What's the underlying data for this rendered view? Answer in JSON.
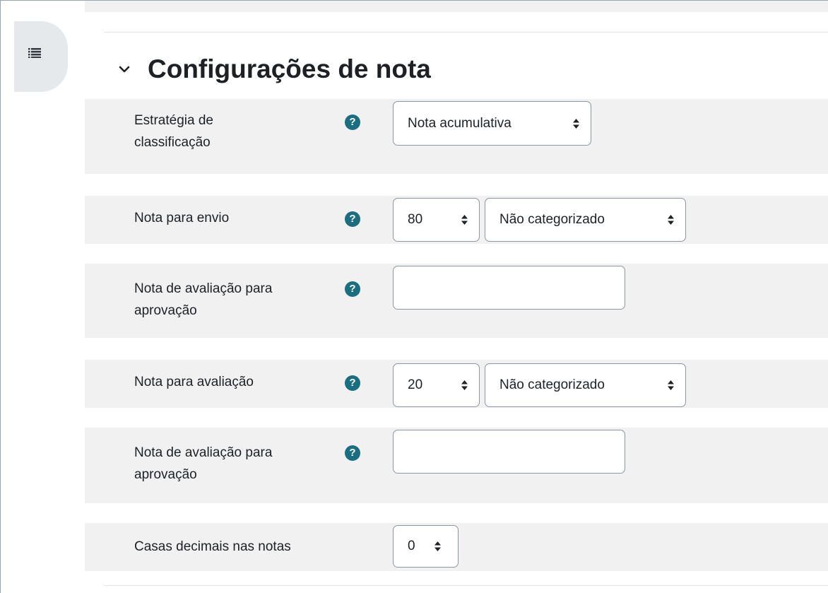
{
  "drawer": {
    "icon": "list-icon"
  },
  "section": {
    "title": "Configurações de nota",
    "icon": "chevron-down-icon"
  },
  "help_icon_glyph": "?",
  "rows": {
    "grading_strategy": {
      "label_line1": "Estratégia de",
      "label_line2": "classificação",
      "select_value": "Nota acumulativa"
    },
    "submission_grade": {
      "label": "Nota para envio",
      "grade_value": "80",
      "category_value": "Não categorizado"
    },
    "submission_pass": {
      "label_line1": "Nota de avaliação para",
      "label_line2": "aprovação",
      "input_value": ""
    },
    "assessment_grade": {
      "label": "Nota para avaliação",
      "grade_value": "20",
      "category_value": "Não categorizado"
    },
    "assessment_pass": {
      "label_line1": "Nota de avaliação para",
      "label_line2": "aprovação",
      "input_value": ""
    },
    "decimals": {
      "label": "Casas decimais nas notas",
      "select_value": "0"
    }
  },
  "colors": {
    "row_bg": "#f1f1f2",
    "help_icon": "#1b6e80",
    "border": "#8f959e",
    "drawer_bg": "#e6e9ec"
  }
}
